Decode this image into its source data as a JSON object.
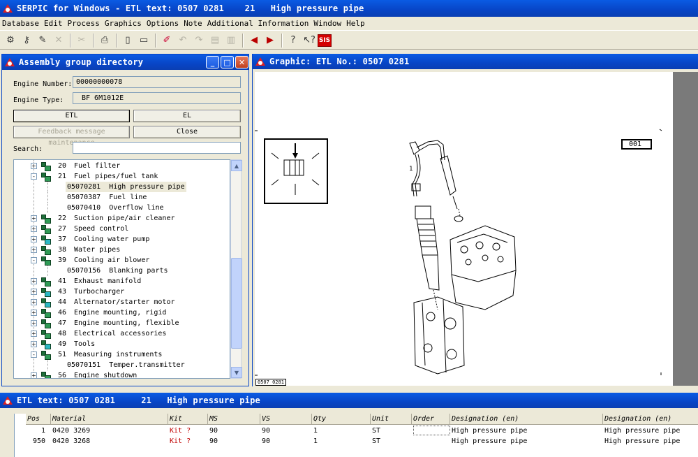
{
  "app": {
    "title": "SERPIC for Windows - ETL text: 0507 0281    21   High pressure pipe"
  },
  "menu": [
    "Database",
    "Edit",
    "Process",
    "Graphics",
    "Options",
    "Note",
    "Additional Information",
    "Window",
    "Help"
  ],
  "toolbar": {
    "icons": [
      "engine-icon",
      "key-icon",
      "wrench-icon",
      "delete-icon",
      "cut-icon",
      "print-icon",
      "new-document-icon",
      "open-folder-icon",
      "color-pen-icon",
      "undo-icon",
      "redo-icon",
      "page-icon",
      "page2-icon",
      "arrow-left-icon",
      "arrow-right-icon",
      "help-icon",
      "help-pointer-icon",
      "sis-icon"
    ],
    "sis_label": "SIS"
  },
  "assembly": {
    "title": "Assembly group directory",
    "engine_number_label": "Engine Number:",
    "engine_number_value": "00000000078",
    "engine_type_label": "Engine Type:",
    "engine_type_value": "BF 6M1012E",
    "etl_button": "ETL",
    "el_button": "EL",
    "feedback_button": "Feedback message maintenance",
    "close_button": "Close",
    "search_label": "Search:",
    "search_value": "",
    "tree": [
      {
        "code": "20",
        "label": "Fuel filter",
        "level": 0,
        "expander": "+",
        "icon": "green",
        "selected": false
      },
      {
        "code": "21",
        "label": "Fuel pipes/fuel tank",
        "level": 0,
        "expander": "-",
        "icon": "green",
        "selected": false
      },
      {
        "code": "05070281",
        "label": "High pressure pipe",
        "level": 1,
        "expander": "",
        "icon": "",
        "selected": true
      },
      {
        "code": "05070387",
        "label": "Fuel line",
        "level": 1,
        "expander": "",
        "icon": "",
        "selected": false
      },
      {
        "code": "05070410",
        "label": "Overflow line",
        "level": 1,
        "expander": "",
        "icon": "",
        "selected": false
      },
      {
        "code": "22",
        "label": "Suction pipe/air cleaner",
        "level": 0,
        "expander": "+",
        "icon": "green",
        "selected": false
      },
      {
        "code": "27",
        "label": "Speed control",
        "level": 0,
        "expander": "+",
        "icon": "green",
        "selected": false
      },
      {
        "code": "37",
        "label": "Cooling water pump",
        "level": 0,
        "expander": "+",
        "icon": "cyan",
        "selected": false
      },
      {
        "code": "38",
        "label": "Water pipes",
        "level": 0,
        "expander": "+",
        "icon": "green",
        "selected": false
      },
      {
        "code": "39",
        "label": "Cooling air blower",
        "level": 0,
        "expander": "-",
        "icon": "green",
        "selected": false
      },
      {
        "code": "05070156",
        "label": "Blanking parts",
        "level": 1,
        "expander": "",
        "icon": "",
        "selected": false
      },
      {
        "code": "41",
        "label": "Exhaust manifold",
        "level": 0,
        "expander": "+",
        "icon": "green",
        "selected": false
      },
      {
        "code": "43",
        "label": "Turbocharger",
        "level": 0,
        "expander": "+",
        "icon": "cyan",
        "selected": false
      },
      {
        "code": "44",
        "label": "Alternator/starter motor",
        "level": 0,
        "expander": "+",
        "icon": "cyan",
        "selected": false
      },
      {
        "code": "46",
        "label": "Engine mounting, rigid",
        "level": 0,
        "expander": "+",
        "icon": "green",
        "selected": false
      },
      {
        "code": "47",
        "label": "Engine mounting, flexible",
        "level": 0,
        "expander": "+",
        "icon": "green",
        "selected": false
      },
      {
        "code": "48",
        "label": "Electrical accessories",
        "level": 0,
        "expander": "+",
        "icon": "green",
        "selected": false
      },
      {
        "code": "49",
        "label": "Tools",
        "level": 0,
        "expander": "+",
        "icon": "cyan",
        "selected": false
      },
      {
        "code": "51",
        "label": "Measuring instruments",
        "level": 0,
        "expander": "-",
        "icon": "green",
        "selected": false
      },
      {
        "code": "05070151",
        "label": "Temper.transmitter",
        "level": 1,
        "expander": "",
        "icon": "",
        "selected": false
      },
      {
        "code": "56",
        "label": "Engine shutdown",
        "level": 0,
        "expander": "+",
        "icon": "green",
        "selected": false
      }
    ]
  },
  "graphic": {
    "title": "Graphic: ETL No.: 0507 0281",
    "callout": "001",
    "footer_label": "0507 0281",
    "part_label": "1"
  },
  "etl": {
    "title": "ETL text: 0507 0281     21   High pressure pipe",
    "columns": [
      "Pos",
      "Material",
      "Kit",
      "MS",
      "VS",
      "Qty",
      "Unit",
      "Order",
      "Designation (en)",
      "Designation (en)"
    ],
    "rows": [
      {
        "pos": "1",
        "material": "0420 3269",
        "kit": "Kit ?",
        "ms": "90",
        "vs": "90",
        "qty": "1",
        "unit": "ST",
        "order": "",
        "des1": "High pressure pipe",
        "des2": "High pressure pipe"
      },
      {
        "pos": "950",
        "material": "0420 3268",
        "kit": "Kit ?",
        "ms": "90",
        "vs": "90",
        "qty": "1",
        "unit": "ST",
        "order": "",
        "des1": "High pressure pipe",
        "des2": "High pressure pipe"
      }
    ]
  }
}
